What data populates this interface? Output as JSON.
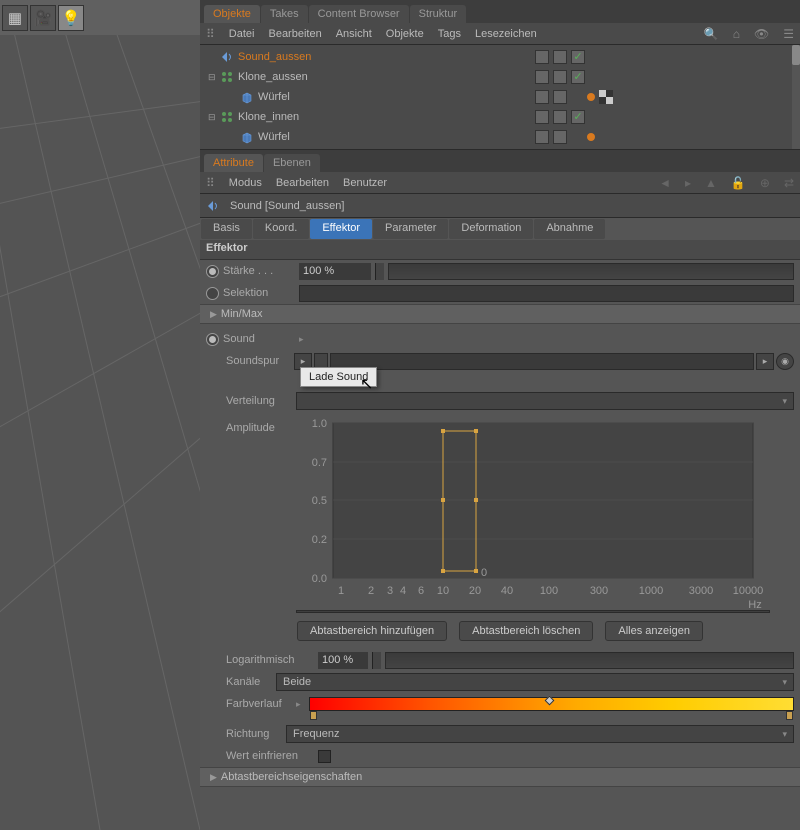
{
  "topTabs": [
    "Objekte",
    "Takes",
    "Content Browser",
    "Struktur"
  ],
  "topTabActive": 0,
  "objMenu": [
    "Datei",
    "Bearbeiten",
    "Ansicht",
    "Objekte",
    "Tags",
    "Lesezeichen"
  ],
  "tree": [
    {
      "name": "Sound_aussen",
      "sel": true,
      "indent": 0,
      "icon": "sound"
    },
    {
      "name": "Klone_aussen",
      "sel": false,
      "indent": 0,
      "icon": "cloner",
      "toggle": "-"
    },
    {
      "name": "Würfel",
      "sel": false,
      "indent": 1,
      "icon": "cube"
    },
    {
      "name": "Klone_innen",
      "sel": false,
      "indent": 0,
      "icon": "cloner",
      "toggle": "-"
    },
    {
      "name": "Würfel",
      "sel": false,
      "indent": 1,
      "icon": "cube"
    }
  ],
  "attrTabs": [
    "Attribute",
    "Ebenen"
  ],
  "attrTabActive": 0,
  "attrMenu": [
    "Modus",
    "Bearbeiten",
    "Benutzer"
  ],
  "objectTitle": "Sound [Sound_aussen]",
  "propTabs": [
    "Basis",
    "Koord.",
    "Effektor",
    "Parameter",
    "Deformation",
    "Abnahme"
  ],
  "propTabActive": 2,
  "sectionEffektor": "Effektor",
  "fields": {
    "staerke_label": "Stärke . . .",
    "staerke_value": "100 %",
    "selektion_label": "Selektion",
    "minmax_label": "Min/Max",
    "sound_label": "Sound",
    "soundspur_label": "Soundspur",
    "soundspur_popup": "Lade Sound",
    "verteilung_label": "Verteilung",
    "amplitude_label": "Amplitude",
    "btn_add": "Abtastbereich hinzufügen",
    "btn_del": "Abtastbereich löschen",
    "btn_all": "Alles anzeigen",
    "log_label": "Logarithmisch",
    "log_value": "100 %",
    "kanaele_label": "Kanäle",
    "kanaele_value": "Beide",
    "farbverlauf_label": "Farbverlauf",
    "richtung_label": "Richtung",
    "richtung_value": "Frequenz",
    "wert_label": "Wert einfrieren",
    "abtast_label": "Abtastbereichseigenschaften"
  },
  "chart_data": {
    "type": "line",
    "title": "",
    "xlabel": "Hz",
    "ylabel": "",
    "xscale": "log",
    "x_ticks": [
      1,
      2,
      3,
      4,
      6,
      10,
      20,
      40,
      100,
      300,
      1000,
      3000,
      10000
    ],
    "y_ticks": [
      0.0,
      0.2,
      0.5,
      0.7,
      1.0
    ],
    "xlim": [
      1,
      10000
    ],
    "ylim": [
      0,
      1
    ],
    "selection_box": {
      "x0": 10,
      "x1": 20,
      "y0": 0.0,
      "y1": 1.0
    },
    "series": [
      {
        "name": "amplitude",
        "values": [
          0
        ]
      }
    ],
    "baseline_label": "0"
  },
  "colors": {
    "accent": "#d97a1f",
    "active_tab": "#3b74b8"
  }
}
